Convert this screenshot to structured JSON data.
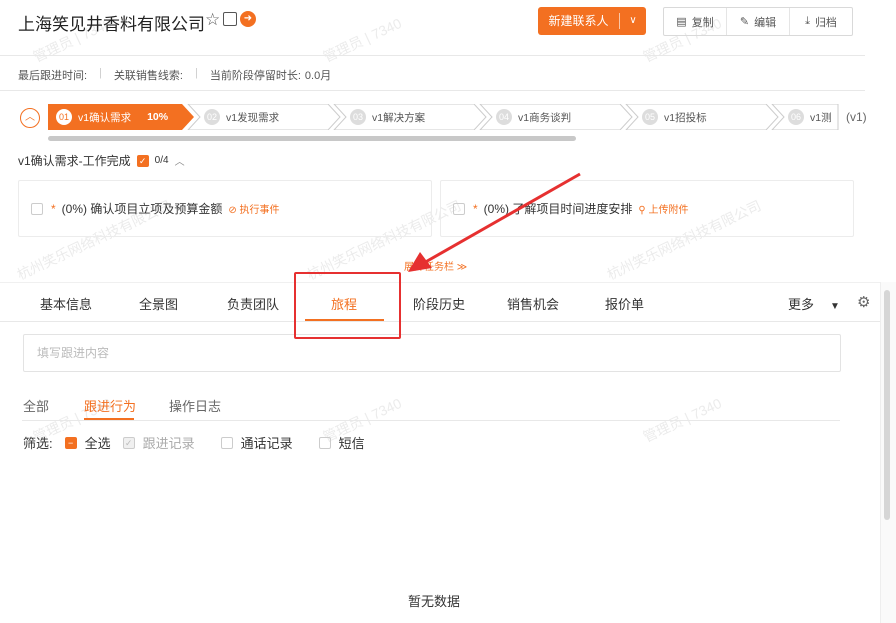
{
  "header": {
    "title": "上海笑见井香料有限公司",
    "star_icon": "star-icon",
    "new_contact": "新建联系人",
    "actions": [
      "复制",
      "编辑",
      "归档"
    ]
  },
  "info_bar": {
    "last_followup": "最后跟进时间:",
    "related_leads": "关联销售线索:",
    "stage_duration": "当前阶段停留时长:",
    "stage_duration_value": "0.0月"
  },
  "stages": [
    {
      "num": "01",
      "label": "v1确认需求",
      "pct": "10%",
      "active": true
    },
    {
      "num": "02",
      "label": "v1发现需求"
    },
    {
      "num": "03",
      "label": "v1解决方案"
    },
    {
      "num": "04",
      "label": "v1商务谈判"
    },
    {
      "num": "05",
      "label": "v1招投标"
    },
    {
      "num": "06",
      "label": "v1测"
    }
  ],
  "stage_suffix": "(v1)",
  "task": {
    "title": "v1确认需求-工作完成",
    "count": "0/4",
    "cards": [
      {
        "text": "(0%)  确认项目立项及预算金额",
        "link": "执行事件"
      },
      {
        "text": "(0%)  了解项目时间进度安排",
        "link": "上传附件"
      }
    ],
    "expand": "展开任务栏"
  },
  "tabs": [
    "基本信息",
    "全景图",
    "负责团队",
    "旅程",
    "阶段历史",
    "销售机会",
    "报价单"
  ],
  "active_tab": "旅程",
  "more": "更多",
  "input_placeholder": "填写跟进内容",
  "subtabs": [
    "全部",
    "跟进行为",
    "操作日志"
  ],
  "filter": {
    "label": "筛选:",
    "options": [
      "全选",
      "跟进记录",
      "通话记录",
      "短信"
    ]
  },
  "empty": "暂无数据",
  "watermark": "管理员 | 7340",
  "watermark2": "杭州笑乐网络科技有限公司",
  "colors": {
    "accent": "#f37021",
    "annotation": "#e63030"
  }
}
